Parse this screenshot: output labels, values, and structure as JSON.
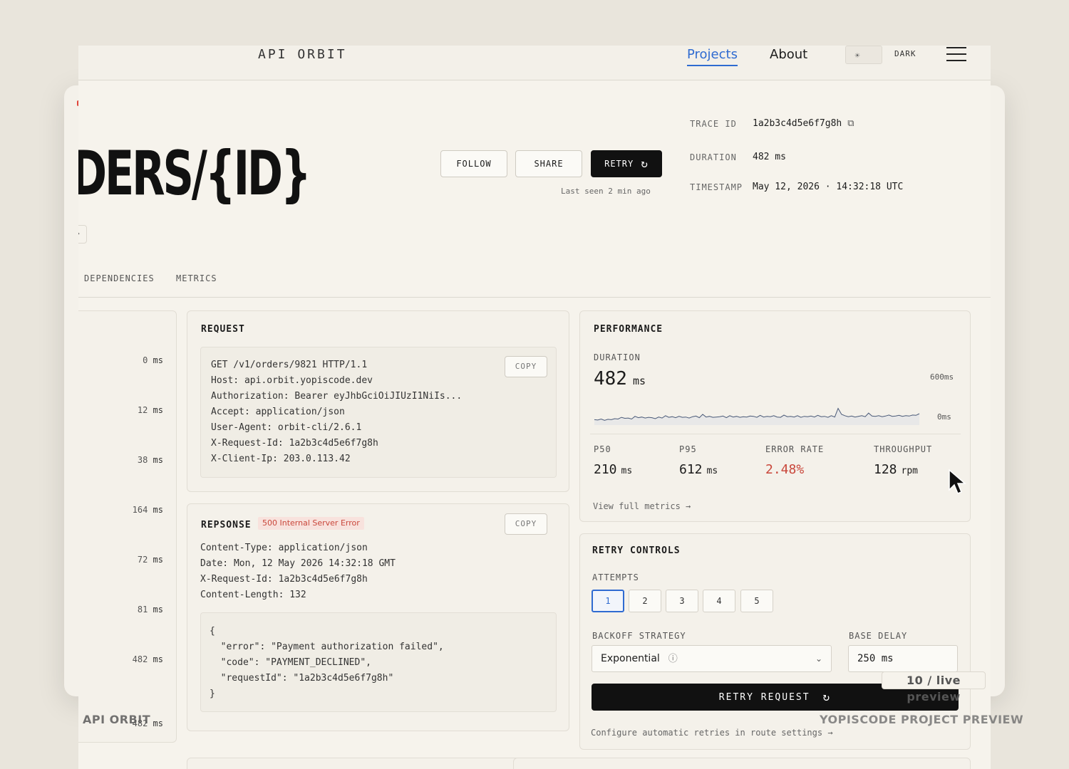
{
  "header": {
    "brand": "API ORBIT",
    "nav": [
      {
        "label": "Projects",
        "active": true
      },
      {
        "label": "About",
        "active": false
      }
    ],
    "theme_label": "DARK",
    "accent_color": "#2f6bd1"
  },
  "route": {
    "title": "DERS/{ID}",
    "actions": {
      "follow": "FOLLOW",
      "share": "SHARE",
      "retry": "RETRY"
    },
    "last_seen": "Last seen 2 min ago"
  },
  "meta": {
    "trace_id_label": "TRACE ID",
    "trace_id": "1a2b3c4d5e6f7g8h",
    "duration_label": "DURATION",
    "duration": "482 ms",
    "timestamp_label": "TIMESTAMP",
    "timestamp": "May 12, 2026 · 14:32:18 UTC"
  },
  "tabs": [
    "DEPENDENCIES",
    "METRICS"
  ],
  "timeline": {
    "values": [
      "0",
      "12",
      "38",
      "164",
      "72",
      "81",
      "482",
      "482"
    ],
    "unit": "ms"
  },
  "request": {
    "title": "REQUEST",
    "copy": "COPY",
    "lines": [
      "GET /v1/orders/9821 HTTP/1.1",
      "Host: api.orbit.yopiscode.dev",
      "Authorization: Bearer eyJhbGciOiJIUzI1NiIs...",
      "Accept: application/json",
      "User-Agent: orbit-cli/2.6.1",
      "X-Request-Id: 1a2b3c4d5e6f7g8h",
      "X-Client-Ip: 203.0.113.42"
    ]
  },
  "response": {
    "title": "REPSONSE",
    "status": "500 Internal Server Error",
    "status_color": "#c9473b",
    "copy": "COPY",
    "headers": [
      "Content-Type: application/json",
      "Date: Mon, 12 May 2026 14:32:18 GMT",
      "X-Request-Id: 1a2b3c4d5e6f7g8h",
      "Content-Length: 132"
    ],
    "body": [
      "{",
      "  \"error\": \"Payment authorization failed\",",
      "  \"code\": \"PAYMENT_DECLINED\",",
      "  \"requestId\": \"1a2b3c4d5e6f7g8h\"",
      "}"
    ]
  },
  "performance": {
    "title": "PERFORMANCE",
    "duration_label": "DURATION",
    "duration_value": "482",
    "duration_unit": "ms",
    "axis_max": "600ms",
    "axis_min": "0ms",
    "stats": [
      {
        "label": "P50",
        "value": "210",
        "unit": "ms"
      },
      {
        "label": "P95",
        "value": "612",
        "unit": "ms"
      },
      {
        "label": "ERROR RATE",
        "value": "2.48%",
        "unit": ""
      },
      {
        "label": "THROUGHPUT",
        "value": "128",
        "unit": "rpm"
      }
    ],
    "link": "View full metrics →"
  },
  "chart_data": {
    "type": "line",
    "ylim": [
      0,
      600
    ],
    "values": [
      60,
      55,
      70,
      50,
      65,
      60,
      75,
      70,
      95,
      80,
      85,
      70,
      110,
      90,
      100,
      85,
      95,
      90,
      75,
      100,
      85,
      120,
      95,
      105,
      90,
      110,
      95,
      100,
      85,
      105,
      115,
      90,
      140,
      100,
      110,
      95,
      100,
      105,
      115,
      90,
      120,
      100,
      110,
      95,
      105,
      100,
      115,
      110,
      95,
      125,
      100,
      110,
      105,
      120,
      100,
      95,
      130,
      105,
      110,
      100,
      120,
      95,
      110,
      105,
      115,
      100,
      125,
      105,
      110,
      95,
      120,
      100,
      230,
      140,
      120,
      105,
      115,
      100,
      110,
      120,
      105,
      160,
      115,
      110,
      120,
      105,
      115,
      130,
      110,
      115,
      125,
      110,
      120,
      115,
      130,
      125,
      150
    ]
  },
  "retry": {
    "title": "RETRY CONTROLS",
    "attempts_label": "ATTEMPTS",
    "attempts": [
      "1",
      "2",
      "3",
      "4",
      "5"
    ],
    "active_attempt": "1",
    "strategy_label": "BACKOFF STRATEGY",
    "strategy_value": "Exponential",
    "delay_label": "BASE DELAY",
    "delay_value": "250 ms",
    "button": "RETRY REQUEST",
    "configure": "Configure automatic retries in route settings →"
  },
  "overlays": {
    "preview_badge": "10 / live preview",
    "left_caption": "API ORBIT",
    "right_caption": "YOPISCODE PROJECT PREVIEW"
  }
}
